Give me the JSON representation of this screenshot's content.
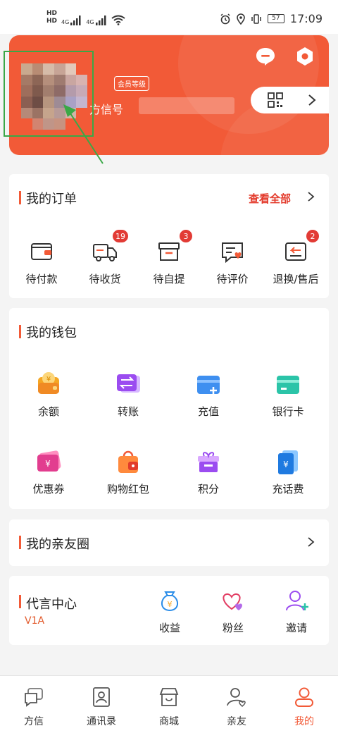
{
  "status_bar": {
    "time": "17:09",
    "battery": "57",
    "network_left": "HD",
    "network_left2": "HD",
    "sig1": "4G",
    "sig2": "4G"
  },
  "profile": {
    "level_badge": "会员等级",
    "name": "方信号"
  },
  "orders": {
    "title": "我的订单",
    "see_all": "查看全部",
    "items": [
      {
        "label": "待付款",
        "icon": "wallet-icon",
        "badge": ""
      },
      {
        "label": "待收货",
        "icon": "truck-icon",
        "badge": "19"
      },
      {
        "label": "待自提",
        "icon": "box-icon",
        "badge": "3"
      },
      {
        "label": "待评价",
        "icon": "comment-heart-icon",
        "badge": ""
      },
      {
        "label": "退换/售后",
        "icon": "return-icon",
        "badge": "2"
      }
    ]
  },
  "wallet": {
    "title": "我的钱包",
    "items": [
      {
        "label": "余额",
        "icon": "balance-icon"
      },
      {
        "label": "转账",
        "icon": "transfer-icon"
      },
      {
        "label": "充值",
        "icon": "recharge-icon"
      },
      {
        "label": "银行卡",
        "icon": "bank-card-icon"
      },
      {
        "label": "优惠券",
        "icon": "coupon-icon"
      },
      {
        "label": "购物红包",
        "icon": "red-packet-icon"
      },
      {
        "label": "积分",
        "icon": "points-icon"
      },
      {
        "label": "充话费",
        "icon": "phone-bill-icon"
      }
    ]
  },
  "friends": {
    "title": "我的亲友圈"
  },
  "ambassador": {
    "title": "代言中心",
    "level": "V1A",
    "items": [
      {
        "label": "收益",
        "icon": "money-bag-icon"
      },
      {
        "label": "粉丝",
        "icon": "hearts-icon"
      },
      {
        "label": "邀请",
        "icon": "add-user-icon"
      }
    ]
  },
  "nav": {
    "items": [
      {
        "label": "方信",
        "icon": "chat-icon"
      },
      {
        "label": "通讯录",
        "icon": "contacts-icon"
      },
      {
        "label": "商城",
        "icon": "store-icon"
      },
      {
        "label": "亲友",
        "icon": "friends-icon"
      },
      {
        "label": "我的",
        "icon": "person-icon"
      }
    ],
    "active_index": 4
  },
  "colors": {
    "brand": "#f25a37",
    "accent_red": "#e33a2b"
  }
}
